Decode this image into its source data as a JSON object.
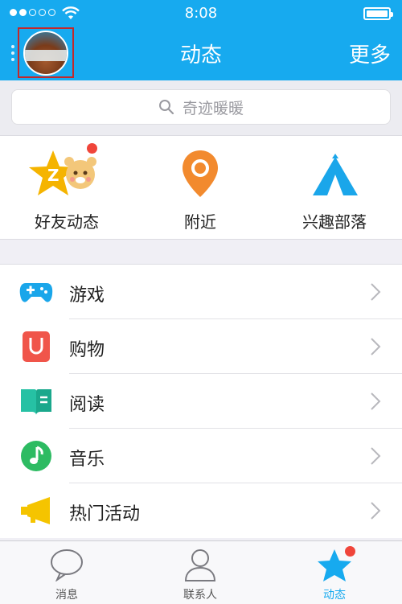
{
  "status": {
    "time": "8:08"
  },
  "nav": {
    "title": "动态",
    "more": "更多"
  },
  "search": {
    "placeholder": "奇迹暖暖"
  },
  "quick": [
    {
      "label": "好友动态",
      "icon": "friend-feed-star-icon"
    },
    {
      "label": "附近",
      "icon": "location-pin-icon"
    },
    {
      "label": "兴趣部落",
      "icon": "tent-icon"
    }
  ],
  "list": [
    {
      "label": "游戏",
      "icon": "gamepad-icon"
    },
    {
      "label": "购物",
      "icon": "shopping-bag-icon"
    },
    {
      "label": "阅读",
      "icon": "book-icon"
    },
    {
      "label": "音乐",
      "icon": "music-note-icon"
    },
    {
      "label": "热门活动",
      "icon": "megaphone-icon"
    }
  ],
  "tabs": [
    {
      "label": "消息",
      "icon": "chat-bubble-icon"
    },
    {
      "label": "联系人",
      "icon": "contact-person-icon"
    },
    {
      "label": "动态",
      "icon": "star-feed-icon"
    }
  ],
  "colors": {
    "accent": "#17aaef",
    "badge": "#f0453a"
  }
}
